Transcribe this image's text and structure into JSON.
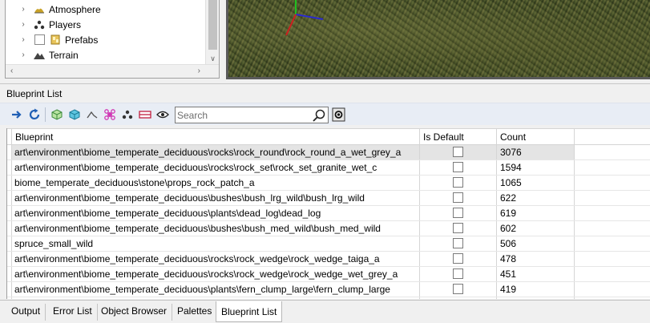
{
  "scene_tree": {
    "items": [
      {
        "label": "Atmosphere",
        "icon": "atmosphere-icon",
        "has_checkbox": false
      },
      {
        "label": "Players",
        "icon": "players-icon",
        "has_checkbox": false
      },
      {
        "label": "Prefabs",
        "icon": "prefabs-icon",
        "has_checkbox": true
      },
      {
        "label": "Terrain",
        "icon": "terrain-icon",
        "has_checkbox": false
      }
    ]
  },
  "panel": {
    "title": "Blueprint List"
  },
  "toolbar": {
    "buttons": [
      {
        "name": "add-arrow-button",
        "icon": "arrow-right-icon"
      },
      {
        "name": "refresh-button",
        "icon": "refresh-icon"
      },
      {
        "name": "filter-static-button",
        "icon": "cube-green-icon"
      },
      {
        "name": "filter-entity-button",
        "icon": "cube-teal-icon"
      },
      {
        "name": "filter-terrain-button",
        "icon": "terrain-shape-icon"
      },
      {
        "name": "filter-particle-button",
        "icon": "particle-icon"
      },
      {
        "name": "filter-team-button",
        "icon": "team-icon"
      },
      {
        "name": "filter-trigger-button",
        "icon": "trigger-icon"
      },
      {
        "name": "filter-visibility-button",
        "icon": "eye-icon"
      }
    ],
    "search_placeholder": "Search",
    "search_value": ""
  },
  "grid": {
    "columns": {
      "blueprint": "Blueprint",
      "is_default": "Is Default",
      "count": "Count"
    },
    "rows": [
      {
        "blueprint": "art\\environment\\biome_temperate_deciduous\\rocks\\rock_round\\rock_round_a_wet_grey_a",
        "is_default": false,
        "count": "3076",
        "selected": true
      },
      {
        "blueprint": "art\\environment\\biome_temperate_deciduous\\rocks\\rock_set\\rock_set_granite_wet_c",
        "is_default": false,
        "count": "1594",
        "selected": false
      },
      {
        "blueprint": "biome_temperate_deciduous\\stone\\props_rock_patch_a",
        "is_default": false,
        "count": "1065",
        "selected": false
      },
      {
        "blueprint": "art\\environment\\biome_temperate_deciduous\\bushes\\bush_lrg_wild\\bush_lrg_wild",
        "is_default": false,
        "count": "622",
        "selected": false
      },
      {
        "blueprint": "art\\environment\\biome_temperate_deciduous\\plants\\dead_log\\dead_log",
        "is_default": false,
        "count": "619",
        "selected": false
      },
      {
        "blueprint": "art\\environment\\biome_temperate_deciduous\\bushes\\bush_med_wild\\bush_med_wild",
        "is_default": false,
        "count": "602",
        "selected": false
      },
      {
        "blueprint": "spruce_small_wild",
        "is_default": false,
        "count": "506",
        "selected": false
      },
      {
        "blueprint": "art\\environment\\biome_temperate_deciduous\\rocks\\rock_wedge\\rock_wedge_taiga_a",
        "is_default": false,
        "count": "478",
        "selected": false
      },
      {
        "blueprint": "art\\environment\\biome_temperate_deciduous\\rocks\\rock_wedge\\rock_wedge_wet_grey_a",
        "is_default": false,
        "count": "451",
        "selected": false
      },
      {
        "blueprint": "art\\environment\\biome_temperate_deciduous\\plants\\fern_clump_large\\fern_clump_large",
        "is_default": false,
        "count": "419",
        "selected": false
      },
      {
        "blueprint": "",
        "is_default": false,
        "count": "",
        "selected": false
      }
    ]
  },
  "tabs": [
    {
      "label": "Output",
      "active": false
    },
    {
      "label": "Error List",
      "active": false
    },
    {
      "label": "Object Browser",
      "active": false
    },
    {
      "label": "Palettes",
      "active": false
    },
    {
      "label": "Blueprint List",
      "active": true
    }
  ],
  "colors": {
    "toolbar_bg": "#e8edf5",
    "selected_row": "#e4e4e4",
    "refresh_blue": "#1f5fb5",
    "gizmo_x": "#2a2ad0",
    "gizmo_y": "#20c020",
    "gizmo_z": "#d02020"
  }
}
